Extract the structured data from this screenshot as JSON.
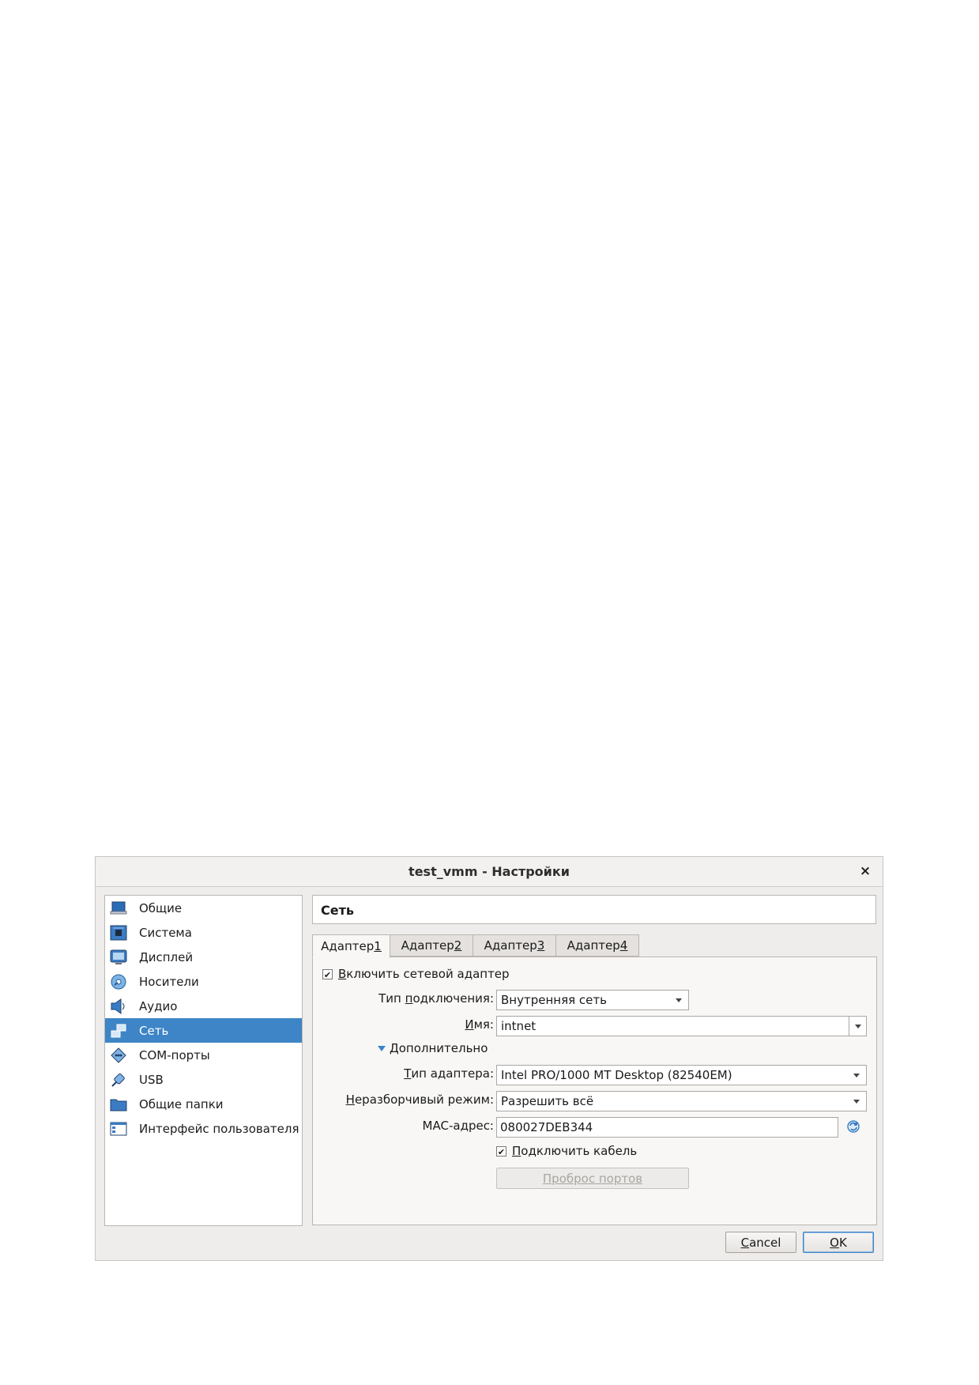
{
  "window": {
    "title": "test_vmm - Настройки",
    "close_glyph": "×"
  },
  "sidebar": {
    "items": [
      {
        "label": "Общие",
        "icon": "general-icon"
      },
      {
        "label": "Система",
        "icon": "system-icon"
      },
      {
        "label": "Дисплей",
        "icon": "display-icon"
      },
      {
        "label": "Носители",
        "icon": "storage-icon"
      },
      {
        "label": "Аудио",
        "icon": "audio-icon"
      },
      {
        "label": "Сеть",
        "icon": "network-icon",
        "selected": true
      },
      {
        "label": "COM-порты",
        "icon": "serial-ports-icon"
      },
      {
        "label": "USB",
        "icon": "usb-icon"
      },
      {
        "label": "Общие папки",
        "icon": "shared-folders-icon"
      },
      {
        "label": "Интерфейс пользователя",
        "icon": "user-interface-icon"
      }
    ]
  },
  "main": {
    "section_title": "Сеть",
    "tabs": [
      {
        "prefix": "Адаптер ",
        "mnemonic": "1",
        "selected": true
      },
      {
        "prefix": "Адаптер ",
        "mnemonic": "2"
      },
      {
        "prefix": "Адаптер ",
        "mnemonic": "3"
      },
      {
        "prefix": "Адаптер ",
        "mnemonic": "4"
      }
    ],
    "enable_adapter": {
      "mnemonic": "В",
      "rest": "ключить сетевой адаптер",
      "checked": true
    },
    "attached_to": {
      "label_pre": "Тип ",
      "label_mn": "п",
      "label_post": "одключения:",
      "value": "Внутренняя сеть"
    },
    "name": {
      "label_mn": "И",
      "label_post": "мя:",
      "value": "intnet"
    },
    "advanced": {
      "mnemonic": "Д",
      "rest": "ополнительно"
    },
    "adapter_type": {
      "label_mn": "Т",
      "label_post": "ип адаптера:",
      "value": "Intel PRO/1000 MT Desktop (82540EM)"
    },
    "promiscuous": {
      "label_mn": "Н",
      "label_post": "еразборчивый режим:",
      "value": "Разрешить всё"
    },
    "mac": {
      "label_pre": "MAC-а",
      "label_mn": "д",
      "label_post": "рес:",
      "value": "080027DEB344",
      "refresh_icon": "refresh-mac-icon"
    },
    "cable": {
      "mnemonic": "П",
      "rest": "одключить кабель",
      "checked": true
    },
    "port_forwarding": {
      "mnemonic": "П",
      "rest": "роброс портов"
    }
  },
  "footer": {
    "cancel": {
      "mnemonic": "C",
      "rest": "ancel"
    },
    "ok": {
      "mnemonic": "O",
      "rest": "K"
    }
  },
  "colors": {
    "selection": "#3d85c6",
    "dialog_bg": "#efedeb"
  }
}
